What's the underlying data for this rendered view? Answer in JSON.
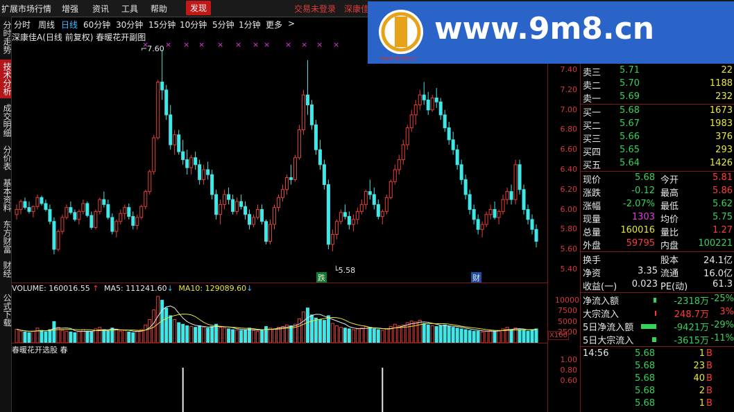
{
  "menu": {
    "items": [
      "扩展市场行情",
      "增强",
      "资讯",
      "工具",
      "帮助"
    ],
    "active": "发现",
    "login": "交易未登录",
    "stock_short": "深康佳"
  },
  "periods": [
    "分时",
    "周线",
    "日线",
    "60分钟",
    "30分钟",
    "15分钟",
    "10分钟",
    "5分钟",
    "1分钟",
    "更多"
  ],
  "period_selected": "日线",
  "chart_arrow": ">",
  "left_tabs": [
    {
      "label": "分时走势",
      "selected": false
    },
    {
      "label": "技术分析",
      "selected": true
    },
    {
      "label": "成交明细",
      "selected": false
    },
    {
      "label": "分价表",
      "selected": false
    },
    {
      "label": "基本资料",
      "selected": false
    },
    {
      "label": "东方财富",
      "selected": false
    },
    {
      "label": "财经",
      "selected": false
    },
    {
      "label": "公式下载",
      "selected": false
    }
  ],
  "chart": {
    "title": "深康佳A(日线 前复权) 春暖花开副图",
    "high_label": "7.60",
    "low_label": "5.58",
    "markers": [
      "跌",
      "财"
    ],
    "price_ticks": [
      "7.40",
      "7.20",
      "7.00",
      "6.80",
      "6.60",
      "6.40",
      "6.20",
      "6.00",
      "5.80",
      "5.60",
      "5.40"
    ],
    "price_range": [
      5.35,
      7.45
    ],
    "volume_label": "VOLUME: 160016.55",
    "ma5_label": "MA5: 111241.60",
    "ma10_label": "MA10: 129089.60",
    "vol_ticks": [
      "10000",
      "7500",
      "5000",
      "2500"
    ],
    "vol_unit": "X100",
    "ind_label": "春暖花开选股  春",
    "ind_ticks": [
      "1.00",
      "0.80",
      "0.60"
    ]
  },
  "chart_data": {
    "type": "candlestick",
    "candles": [
      [
        5.95,
        6.05,
        5.9,
        6.0
      ],
      [
        6.0,
        6.1,
        5.95,
        6.08
      ],
      [
        6.08,
        6.12,
        6.0,
        6.02
      ],
      [
        6.02,
        6.08,
        5.96,
        5.98
      ],
      [
        5.98,
        6.04,
        5.92,
        6.03
      ],
      [
        6.03,
        6.15,
        6.0,
        6.12
      ],
      [
        6.12,
        6.14,
        6.04,
        6.06
      ],
      [
        6.06,
        6.1,
        5.98,
        6.0
      ],
      [
        6.0,
        6.05,
        5.85,
        5.88
      ],
      [
        5.88,
        5.92,
        5.55,
        5.6
      ],
      [
        5.6,
        5.8,
        5.58,
        5.78
      ],
      [
        5.78,
        5.95,
        5.75,
        5.92
      ],
      [
        5.92,
        6.05,
        5.9,
        6.02
      ],
      [
        6.02,
        6.08,
        5.95,
        5.97
      ],
      [
        5.97,
        6.0,
        5.88,
        5.9
      ],
      [
        5.9,
        6.0,
        5.85,
        5.98
      ],
      [
        5.98,
        6.1,
        5.95,
        6.06
      ],
      [
        6.06,
        6.08,
        5.92,
        5.94
      ],
      [
        5.94,
        5.98,
        5.8,
        5.82
      ],
      [
        5.82,
        6.0,
        5.8,
        5.98
      ],
      [
        5.98,
        6.12,
        5.95,
        6.1
      ],
      [
        6.1,
        6.18,
        6.02,
        6.05
      ],
      [
        6.05,
        6.1,
        5.9,
        5.92
      ],
      [
        5.92,
        5.96,
        5.75,
        5.78
      ],
      [
        5.78,
        5.9,
        5.72,
        5.88
      ],
      [
        5.88,
        6.0,
        5.85,
        5.96
      ],
      [
        5.96,
        6.05,
        5.9,
        6.02
      ],
      [
        6.02,
        6.06,
        5.9,
        5.93
      ],
      [
        5.93,
        5.98,
        5.8,
        5.84
      ],
      [
        5.84,
        5.95,
        5.8,
        5.92
      ],
      [
        5.92,
        6.05,
        5.9,
        6.03
      ],
      [
        6.03,
        6.2,
        6.0,
        6.18
      ],
      [
        6.18,
        6.4,
        6.15,
        6.38
      ],
      [
        6.38,
        6.75,
        6.35,
        6.72
      ],
      [
        6.72,
        7.3,
        6.7,
        7.28
      ],
      [
        7.28,
        7.6,
        7.1,
        7.2
      ],
      [
        7.2,
        7.25,
        6.9,
        6.95
      ],
      [
        6.95,
        7.05,
        6.6,
        6.65
      ],
      [
        6.65,
        6.8,
        6.55,
        6.75
      ],
      [
        6.75,
        6.8,
        6.55,
        6.58
      ],
      [
        6.58,
        6.7,
        6.45,
        6.5
      ],
      [
        6.5,
        6.6,
        6.35,
        6.42
      ],
      [
        6.42,
        6.55,
        6.35,
        6.52
      ],
      [
        6.52,
        6.58,
        6.4,
        6.45
      ],
      [
        6.45,
        6.5,
        6.25,
        6.3
      ],
      [
        6.3,
        6.45,
        6.25,
        6.4
      ],
      [
        6.4,
        6.48,
        6.3,
        6.35
      ],
      [
        6.35,
        6.4,
        6.1,
        6.15
      ],
      [
        6.15,
        6.2,
        5.9,
        5.95
      ],
      [
        5.95,
        6.1,
        5.85,
        6.05
      ],
      [
        6.05,
        6.2,
        6.0,
        6.15
      ],
      [
        6.15,
        6.22,
        6.05,
        6.1
      ],
      [
        6.1,
        6.15,
        5.95,
        5.98
      ],
      [
        5.98,
        6.12,
        5.95,
        6.08
      ],
      [
        6.08,
        6.15,
        6.0,
        6.03
      ],
      [
        6.03,
        6.08,
        5.9,
        5.95
      ],
      [
        5.95,
        6.0,
        5.8,
        5.85
      ],
      [
        5.85,
        5.95,
        5.82,
        5.92
      ],
      [
        5.92,
        6.05,
        5.9,
        6.0
      ],
      [
        6.0,
        6.05,
        5.85,
        5.88
      ],
      [
        5.88,
        5.9,
        5.65,
        5.68
      ],
      [
        5.68,
        5.9,
        5.65,
        5.85
      ],
      [
        5.85,
        6.05,
        5.8,
        6.02
      ],
      [
        6.02,
        6.15,
        5.98,
        6.12
      ],
      [
        6.12,
        6.25,
        6.08,
        6.2
      ],
      [
        6.2,
        6.35,
        6.15,
        6.32
      ],
      [
        6.32,
        6.45,
        6.25,
        6.3
      ],
      [
        6.3,
        6.55,
        6.28,
        6.52
      ],
      [
        6.52,
        6.85,
        6.5,
        6.8
      ],
      [
        6.8,
        7.2,
        6.75,
        7.15
      ],
      [
        7.15,
        7.5,
        6.95,
        7.05
      ],
      [
        7.05,
        7.1,
        6.8,
        6.85
      ],
      [
        6.85,
        6.9,
        6.55,
        6.6
      ],
      [
        6.6,
        6.7,
        6.4,
        6.45
      ],
      [
        6.45,
        6.5,
        6.2,
        6.25
      ],
      [
        6.25,
        6.3,
        5.6,
        5.65
      ],
      [
        5.65,
        5.8,
        5.58,
        5.75
      ],
      [
        5.75,
        5.9,
        5.7,
        5.88
      ],
      [
        5.88,
        6.0,
        5.85,
        5.97
      ],
      [
        5.97,
        6.05,
        5.9,
        5.93
      ],
      [
        5.93,
        5.98,
        5.8,
        5.85
      ],
      [
        5.85,
        5.95,
        5.78,
        5.9
      ],
      [
        5.9,
        6.02,
        5.85,
        5.98
      ],
      [
        5.98,
        6.1,
        5.95,
        6.05
      ],
      [
        6.05,
        6.2,
        6.0,
        6.18
      ],
      [
        6.18,
        6.3,
        6.1,
        6.15
      ],
      [
        6.15,
        6.22,
        6.0,
        6.05
      ],
      [
        6.05,
        6.1,
        5.9,
        5.93
      ],
      [
        5.93,
        6.0,
        5.85,
        5.98
      ],
      [
        5.98,
        6.15,
        5.95,
        6.12
      ],
      [
        6.12,
        6.3,
        6.1,
        6.28
      ],
      [
        6.28,
        6.45,
        6.25,
        6.4
      ],
      [
        6.4,
        6.55,
        6.35,
        6.5
      ],
      [
        6.5,
        6.7,
        6.45,
        6.65
      ],
      [
        6.65,
        6.85,
        6.6,
        6.82
      ],
      [
        6.82,
        7.0,
        6.78,
        6.95
      ],
      [
        6.95,
        7.1,
        6.85,
        7.05
      ],
      [
        7.05,
        7.2,
        7.0,
        7.15
      ],
      [
        7.15,
        7.28,
        7.05,
        7.1
      ],
      [
        7.1,
        7.18,
        6.95,
        7.0
      ],
      [
        7.0,
        7.15,
        6.98,
        7.12
      ],
      [
        7.12,
        7.22,
        7.02,
        7.08
      ],
      [
        7.08,
        7.12,
        6.9,
        6.95
      ],
      [
        6.95,
        7.0,
        6.78,
        6.82
      ],
      [
        6.82,
        6.88,
        6.65,
        6.7
      ],
      [
        6.7,
        6.78,
        6.55,
        6.6
      ],
      [
        6.6,
        6.65,
        6.4,
        6.45
      ],
      [
        6.45,
        6.5,
        6.25,
        6.3
      ],
      [
        6.3,
        6.35,
        6.1,
        6.15
      ],
      [
        6.15,
        6.2,
        5.95,
        6.0
      ],
      [
        6.0,
        6.05,
        5.85,
        5.9
      ],
      [
        5.9,
        5.95,
        5.75,
        5.8
      ],
      [
        5.8,
        5.88,
        5.72,
        5.85
      ],
      [
        5.85,
        5.98,
        5.82,
        5.95
      ],
      [
        5.95,
        6.05,
        5.9,
        6.0
      ],
      [
        6.0,
        6.08,
        5.9,
        5.92
      ],
      [
        5.92,
        6.0,
        5.85,
        5.98
      ],
      [
        5.98,
        6.15,
        5.95,
        6.1
      ],
      [
        6.1,
        6.22,
        6.05,
        6.18
      ],
      [
        6.18,
        6.25,
        6.05,
        6.1
      ],
      [
        6.1,
        6.5,
        6.05,
        6.45
      ],
      [
        6.45,
        6.5,
        6.15,
        6.2
      ],
      [
        6.2,
        6.25,
        5.95,
        6.0
      ],
      [
        6.0,
        6.05,
        5.85,
        5.9
      ],
      [
        5.9,
        5.95,
        5.75,
        5.8
      ],
      [
        5.8,
        5.85,
        5.62,
        5.68
      ]
    ],
    "volumes": [
      35,
      30,
      28,
      26,
      30,
      38,
      32,
      28,
      34,
      55,
      40,
      32,
      30,
      28,
      26,
      30,
      34,
      30,
      28,
      36,
      40,
      34,
      30,
      38,
      34,
      30,
      32,
      28,
      26,
      30,
      34,
      46,
      60,
      85,
      120,
      110,
      90,
      70,
      60,
      52,
      48,
      44,
      42,
      40,
      44,
      40,
      38,
      42,
      48,
      40,
      38,
      36,
      34,
      33,
      32,
      34,
      38,
      32,
      30,
      32,
      42,
      38,
      36,
      40,
      42,
      46,
      44,
      48,
      62,
      80,
      90,
      72,
      64,
      60,
      58,
      70,
      50,
      44,
      40,
      38,
      36,
      34,
      36,
      38,
      42,
      40,
      36,
      34,
      32,
      36,
      42,
      48,
      44,
      46,
      52,
      56,
      54,
      58,
      50,
      46,
      44,
      42,
      44,
      46,
      42,
      40,
      38,
      36,
      34,
      32,
      30,
      30,
      28,
      30,
      32,
      30,
      32,
      36,
      40,
      34,
      38,
      34,
      32,
      30,
      34,
      36
    ],
    "signals": [
      40,
      88
    ],
    "vol_max": 12000
  },
  "logo": {
    "text": "www.9m8.cn",
    "small": "www.9m8.cn"
  },
  "quote": {
    "sell": [
      {
        "label": "卖三",
        "price": "5.71",
        "vol": "22"
      },
      {
        "label": "卖二",
        "price": "5.70",
        "vol": "1188"
      },
      {
        "label": "卖一",
        "price": "5.69",
        "vol": "232"
      }
    ],
    "buy": [
      {
        "label": "买一",
        "price": "5.68",
        "vol": "1673"
      },
      {
        "label": "买二",
        "price": "5.67",
        "vol": "1983"
      },
      {
        "label": "买三",
        "price": "5.66",
        "vol": "376"
      },
      {
        "label": "买四",
        "price": "5.65",
        "vol": "293"
      },
      {
        "label": "买五",
        "price": "5.64",
        "vol": "1426"
      }
    ],
    "stats": [
      {
        "l1": "现价",
        "v1": "5.68",
        "c1": "grn",
        "l2": "今开",
        "v2": "5.81",
        "c2": "red"
      },
      {
        "l1": "涨跌",
        "v1": "-0.12",
        "c1": "grn",
        "l2": "最高",
        "v2": "5.86",
        "c2": "red"
      },
      {
        "l1": "涨幅",
        "v1": "-2.07%",
        "c1": "grn",
        "l2": "最低",
        "v2": "5.62",
        "c2": "grn"
      },
      {
        "l1": "现量",
        "v1": "1303",
        "c1": "mag",
        "l2": "均价",
        "v2": "5.75",
        "c2": "grn"
      },
      {
        "l1": "总量",
        "v1": "160016",
        "c1": "yel",
        "l2": "量比",
        "v2": "1.27",
        "c2": "red"
      },
      {
        "l1": "外盘",
        "v1": "59795",
        "c1": "red",
        "l2": "内盘",
        "v2": "100221",
        "c2": "grn"
      }
    ],
    "fin": [
      {
        "l1": "换手",
        "v1": "",
        "l2": "股本",
        "v2": "24.1亿"
      },
      {
        "l1": "净资",
        "v1": "3.35",
        "l2": "流通",
        "v2": "16.0亿"
      },
      {
        "l1": "收益(一)",
        "v1": "0.023",
        "l2": "PE(动)",
        "v2": "61.3"
      }
    ],
    "flow": [
      {
        "label": "净流入额",
        "val": "-2318万",
        "pct": "-25%",
        "c": "grn",
        "bar": 4
      },
      {
        "label": "大宗流入",
        "val": "248.7万",
        "pct": "3%",
        "c": "red",
        "bar": 2
      },
      {
        "label": "5日净流入额",
        "val": "-9421万",
        "pct": "-29%",
        "c": "grn",
        "bar": 22
      },
      {
        "label": "5日大宗流入",
        "val": "-3615万",
        "pct": "-11%",
        "c": "grn",
        "bar": 6
      }
    ],
    "ticks_time": "14:56",
    "ticks": [
      {
        "price": "5.68",
        "vol": "1",
        "side": "B"
      },
      {
        "price": "5.68",
        "vol": "23",
        "side": "B"
      },
      {
        "price": "5.68",
        "vol": "40",
        "side": "B"
      },
      {
        "price": "5.68",
        "vol": "2",
        "side": "B"
      },
      {
        "price": "5.68",
        "vol": "1",
        "side": "B"
      }
    ]
  }
}
